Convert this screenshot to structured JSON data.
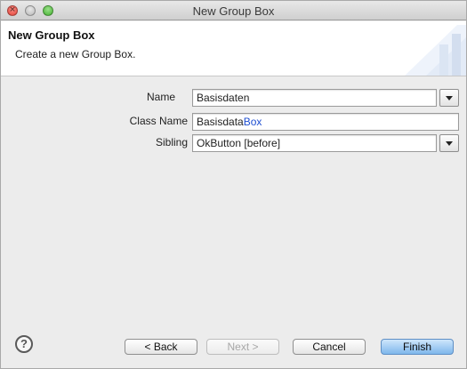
{
  "window": {
    "title": "New Group Box"
  },
  "banner": {
    "title": "New Group Box",
    "message": "Create a new Group Box."
  },
  "form": {
    "name": {
      "label": "Name",
      "value": "Basisdaten"
    },
    "class_name": {
      "label": "Class Name",
      "value_prefix": "Basisdata",
      "value_suffix": "Box"
    },
    "sibling": {
      "label": "Sibling",
      "value": "OkButton [before]"
    }
  },
  "buttons": {
    "back": "< Back",
    "next": "Next >",
    "cancel": "Cancel",
    "finish": "Finish"
  },
  "help": {
    "glyph": "?"
  },
  "colors": {
    "highlight_text": "#1f4fd1",
    "primary_button": "#7fb7ec"
  }
}
